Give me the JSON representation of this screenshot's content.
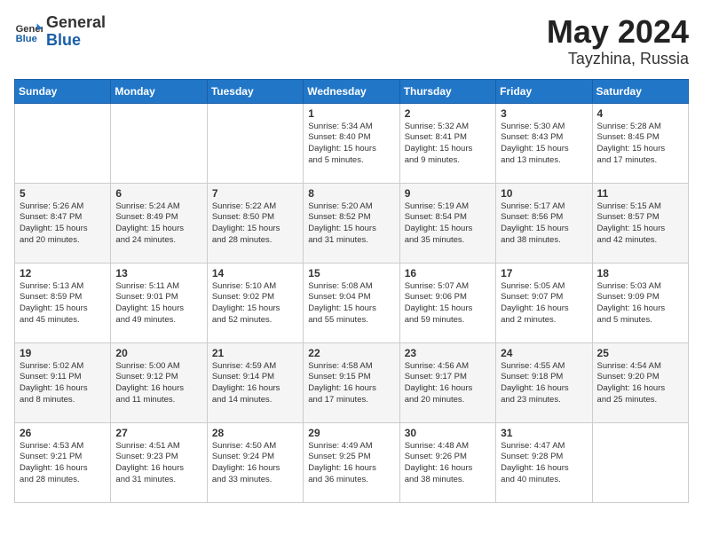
{
  "header": {
    "logo_line1": "General",
    "logo_line2": "Blue",
    "month_year": "May 2024",
    "location": "Tayzhina, Russia"
  },
  "weekdays": [
    "Sunday",
    "Monday",
    "Tuesday",
    "Wednesday",
    "Thursday",
    "Friday",
    "Saturday"
  ],
  "weeks": [
    [
      {
        "day": "",
        "text": ""
      },
      {
        "day": "",
        "text": ""
      },
      {
        "day": "",
        "text": ""
      },
      {
        "day": "1",
        "text": "Sunrise: 5:34 AM\nSunset: 8:40 PM\nDaylight: 15 hours\nand 5 minutes."
      },
      {
        "day": "2",
        "text": "Sunrise: 5:32 AM\nSunset: 8:41 PM\nDaylight: 15 hours\nand 9 minutes."
      },
      {
        "day": "3",
        "text": "Sunrise: 5:30 AM\nSunset: 8:43 PM\nDaylight: 15 hours\nand 13 minutes."
      },
      {
        "day": "4",
        "text": "Sunrise: 5:28 AM\nSunset: 8:45 PM\nDaylight: 15 hours\nand 17 minutes."
      }
    ],
    [
      {
        "day": "5",
        "text": "Sunrise: 5:26 AM\nSunset: 8:47 PM\nDaylight: 15 hours\nand 20 minutes."
      },
      {
        "day": "6",
        "text": "Sunrise: 5:24 AM\nSunset: 8:49 PM\nDaylight: 15 hours\nand 24 minutes."
      },
      {
        "day": "7",
        "text": "Sunrise: 5:22 AM\nSunset: 8:50 PM\nDaylight: 15 hours\nand 28 minutes."
      },
      {
        "day": "8",
        "text": "Sunrise: 5:20 AM\nSunset: 8:52 PM\nDaylight: 15 hours\nand 31 minutes."
      },
      {
        "day": "9",
        "text": "Sunrise: 5:19 AM\nSunset: 8:54 PM\nDaylight: 15 hours\nand 35 minutes."
      },
      {
        "day": "10",
        "text": "Sunrise: 5:17 AM\nSunset: 8:56 PM\nDaylight: 15 hours\nand 38 minutes."
      },
      {
        "day": "11",
        "text": "Sunrise: 5:15 AM\nSunset: 8:57 PM\nDaylight: 15 hours\nand 42 minutes."
      }
    ],
    [
      {
        "day": "12",
        "text": "Sunrise: 5:13 AM\nSunset: 8:59 PM\nDaylight: 15 hours\nand 45 minutes."
      },
      {
        "day": "13",
        "text": "Sunrise: 5:11 AM\nSunset: 9:01 PM\nDaylight: 15 hours\nand 49 minutes."
      },
      {
        "day": "14",
        "text": "Sunrise: 5:10 AM\nSunset: 9:02 PM\nDaylight: 15 hours\nand 52 minutes."
      },
      {
        "day": "15",
        "text": "Sunrise: 5:08 AM\nSunset: 9:04 PM\nDaylight: 15 hours\nand 55 minutes."
      },
      {
        "day": "16",
        "text": "Sunrise: 5:07 AM\nSunset: 9:06 PM\nDaylight: 15 hours\nand 59 minutes."
      },
      {
        "day": "17",
        "text": "Sunrise: 5:05 AM\nSunset: 9:07 PM\nDaylight: 16 hours\nand 2 minutes."
      },
      {
        "day": "18",
        "text": "Sunrise: 5:03 AM\nSunset: 9:09 PM\nDaylight: 16 hours\nand 5 minutes."
      }
    ],
    [
      {
        "day": "19",
        "text": "Sunrise: 5:02 AM\nSunset: 9:11 PM\nDaylight: 16 hours\nand 8 minutes."
      },
      {
        "day": "20",
        "text": "Sunrise: 5:00 AM\nSunset: 9:12 PM\nDaylight: 16 hours\nand 11 minutes."
      },
      {
        "day": "21",
        "text": "Sunrise: 4:59 AM\nSunset: 9:14 PM\nDaylight: 16 hours\nand 14 minutes."
      },
      {
        "day": "22",
        "text": "Sunrise: 4:58 AM\nSunset: 9:15 PM\nDaylight: 16 hours\nand 17 minutes."
      },
      {
        "day": "23",
        "text": "Sunrise: 4:56 AM\nSunset: 9:17 PM\nDaylight: 16 hours\nand 20 minutes."
      },
      {
        "day": "24",
        "text": "Sunrise: 4:55 AM\nSunset: 9:18 PM\nDaylight: 16 hours\nand 23 minutes."
      },
      {
        "day": "25",
        "text": "Sunrise: 4:54 AM\nSunset: 9:20 PM\nDaylight: 16 hours\nand 25 minutes."
      }
    ],
    [
      {
        "day": "26",
        "text": "Sunrise: 4:53 AM\nSunset: 9:21 PM\nDaylight: 16 hours\nand 28 minutes."
      },
      {
        "day": "27",
        "text": "Sunrise: 4:51 AM\nSunset: 9:23 PM\nDaylight: 16 hours\nand 31 minutes."
      },
      {
        "day": "28",
        "text": "Sunrise: 4:50 AM\nSunset: 9:24 PM\nDaylight: 16 hours\nand 33 minutes."
      },
      {
        "day": "29",
        "text": "Sunrise: 4:49 AM\nSunset: 9:25 PM\nDaylight: 16 hours\nand 36 minutes."
      },
      {
        "day": "30",
        "text": "Sunrise: 4:48 AM\nSunset: 9:26 PM\nDaylight: 16 hours\nand 38 minutes."
      },
      {
        "day": "31",
        "text": "Sunrise: 4:47 AM\nSunset: 9:28 PM\nDaylight: 16 hours\nand 40 minutes."
      },
      {
        "day": "",
        "text": ""
      }
    ]
  ]
}
